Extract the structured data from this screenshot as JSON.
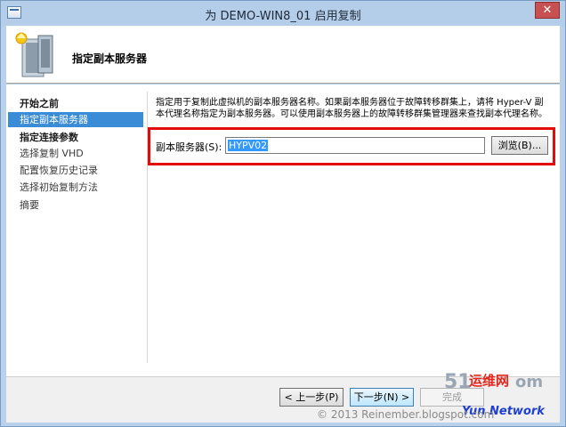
{
  "window": {
    "title": "为 DEMO-WIN8_01 启用复制",
    "close_symbol": "✕"
  },
  "header": {
    "title": "指定副本服务器",
    "icon": "server-wizard-icon"
  },
  "nav": {
    "items": [
      {
        "label": "开始之前"
      },
      {
        "label": "指定副本服务器"
      },
      {
        "label": "指定连接参数"
      },
      {
        "label": "选择复制 VHD"
      },
      {
        "label": "配置恢复历史记录"
      },
      {
        "label": "选择初始复制方法"
      },
      {
        "label": "摘要"
      }
    ]
  },
  "main": {
    "description": "指定用于复制此虚拟机的副本服务器名称。如果副本服务器位于故障转移群集上，请将 Hyper-V 副本代理名称指定为副本服务器。可以使用副本服务器上的故障转移群集管理器来查找副本代理名称。",
    "server_label": "副本服务器(S):",
    "server_value": "HYPV02",
    "browse_label": "浏览(B)..."
  },
  "footer": {
    "prev_label": "< 上一步(P)",
    "next_label": "下一步(N) >",
    "finish_label": "完成"
  },
  "overlay": {
    "copyright": "© 2013 Reinember.blogspot.com",
    "logo_left": "51",
    "logo_chars": "运维网",
    "logo_right": "om",
    "logo_sub": "Yun  Network"
  },
  "colors": {
    "accent": "#3a8cd6",
    "highlight": "#e20c0c"
  }
}
